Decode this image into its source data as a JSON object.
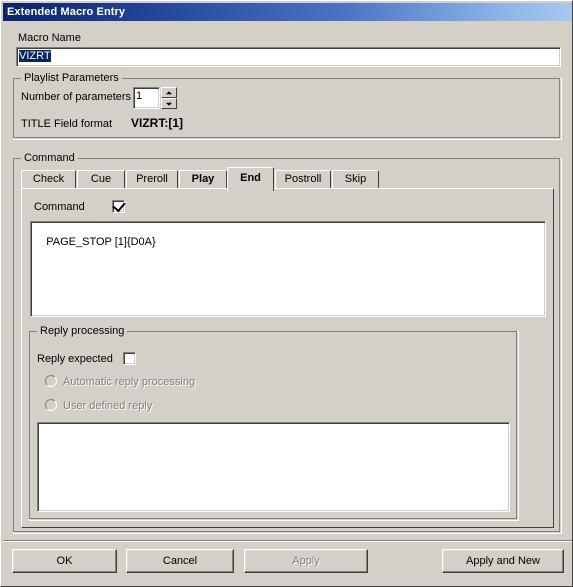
{
  "window": {
    "title": "Extended Macro Entry"
  },
  "macro_name": {
    "label": "Macro Name",
    "value": "VIZRT",
    "placeholder": ""
  },
  "playlist_parameters": {
    "group_title": "Playlist Parameters",
    "number_of_parameters_label": "Number of parameters",
    "number_of_parameters_value": "1",
    "title_field_format_label": "TITLE Field format",
    "title_field_format_value": "VIZRT:[1]"
  },
  "command_group": {
    "group_title": "Command",
    "tabs": [
      {
        "label": "Check",
        "bold": false,
        "active": false
      },
      {
        "label": "Cue",
        "bold": false,
        "active": false
      },
      {
        "label": "Preroll",
        "bold": false,
        "active": false
      },
      {
        "label": "Play",
        "bold": true,
        "active": false
      },
      {
        "label": "End",
        "bold": true,
        "active": true
      },
      {
        "label": "Postroll",
        "bold": false,
        "active": false
      },
      {
        "label": "Skip",
        "bold": false,
        "active": false
      }
    ],
    "command_checkbox_label": "Command",
    "command_checkbox_checked": true,
    "command_text": "PAGE_STOP [1]{D0A}"
  },
  "reply_processing": {
    "group_title": "Reply processing",
    "reply_expected_label": "Reply expected",
    "reply_expected_checked": false,
    "automatic_reply_label": "Automatic reply processing",
    "user_defined_reply_label": "User defined reply",
    "reply_text": ""
  },
  "buttons": {
    "ok": "OK",
    "cancel": "Cancel",
    "apply": "Apply",
    "apply_and_new": "Apply and New"
  },
  "colors": {
    "face": "#d4d0c8",
    "title_start": "#0a246a",
    "title_end": "#a6c8f0",
    "selection": "#0a246a",
    "disabled_text": "#808080"
  }
}
